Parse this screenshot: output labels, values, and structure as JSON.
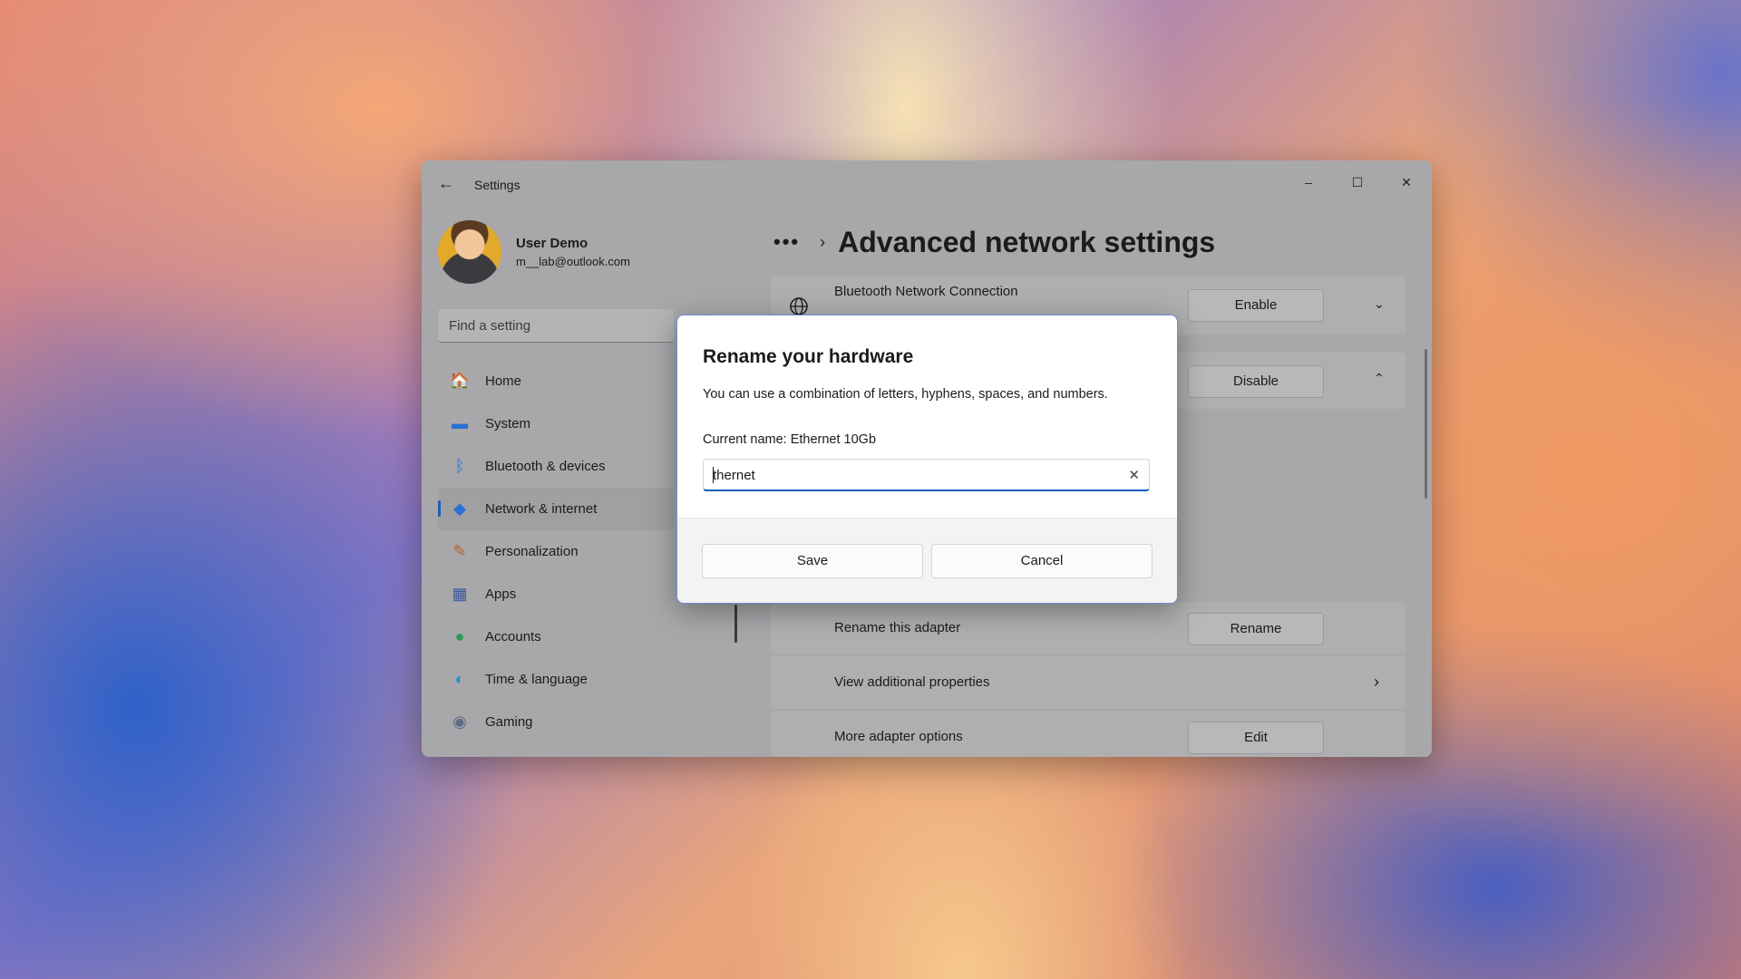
{
  "window": {
    "title": "Settings",
    "back_icon": "back-arrow-icon",
    "controls": {
      "minimize": "–",
      "maximize": "☐",
      "close": "✕"
    }
  },
  "profile": {
    "name": "User Demo",
    "email": "m__lab@outlook.com"
  },
  "search": {
    "placeholder": "Find a setting"
  },
  "nav": {
    "items": [
      {
        "label": "Home",
        "icon": "home-icon",
        "glyph": "🏠"
      },
      {
        "label": "System",
        "icon": "system-icon",
        "glyph": "▬"
      },
      {
        "label": "Bluetooth & devices",
        "icon": "bluetooth-icon",
        "glyph": "ᛒ"
      },
      {
        "label": "Network & internet",
        "icon": "network-icon",
        "glyph": "◆",
        "active": true
      },
      {
        "label": "Personalization",
        "icon": "brush-icon",
        "glyph": "✎"
      },
      {
        "label": "Apps",
        "icon": "apps-icon",
        "glyph": "▦"
      },
      {
        "label": "Accounts",
        "icon": "accounts-icon",
        "glyph": "●"
      },
      {
        "label": "Time & language",
        "icon": "globe-clock-icon",
        "glyph": "◐"
      },
      {
        "label": "Gaming",
        "icon": "gamepad-icon",
        "glyph": "◉"
      }
    ]
  },
  "header": {
    "breadcrumb_more": "•••",
    "page_title": "Advanced network settings"
  },
  "adapters": {
    "bluetooth": {
      "label": "Bluetooth Network Connection",
      "button": "Enable"
    },
    "ethernet": {
      "button": "Disable"
    }
  },
  "settings_rows": [
    {
      "label": "Rename this adapter",
      "button": "Rename"
    },
    {
      "label": "View additional properties"
    },
    {
      "label": "More adapter options",
      "button": "Edit"
    }
  ],
  "dialog": {
    "title": "Rename your hardware",
    "description": "You can use a combination of letters, hyphens, spaces, and numbers.",
    "current_name": "Current name: Ethernet 10Gb",
    "input_value": "thernet",
    "clear_icon": "✕",
    "save_label": "Save",
    "cancel_label": "Cancel"
  },
  "colors": {
    "accent": "#005fb8",
    "nav_indicator": "#1a5fb4"
  }
}
